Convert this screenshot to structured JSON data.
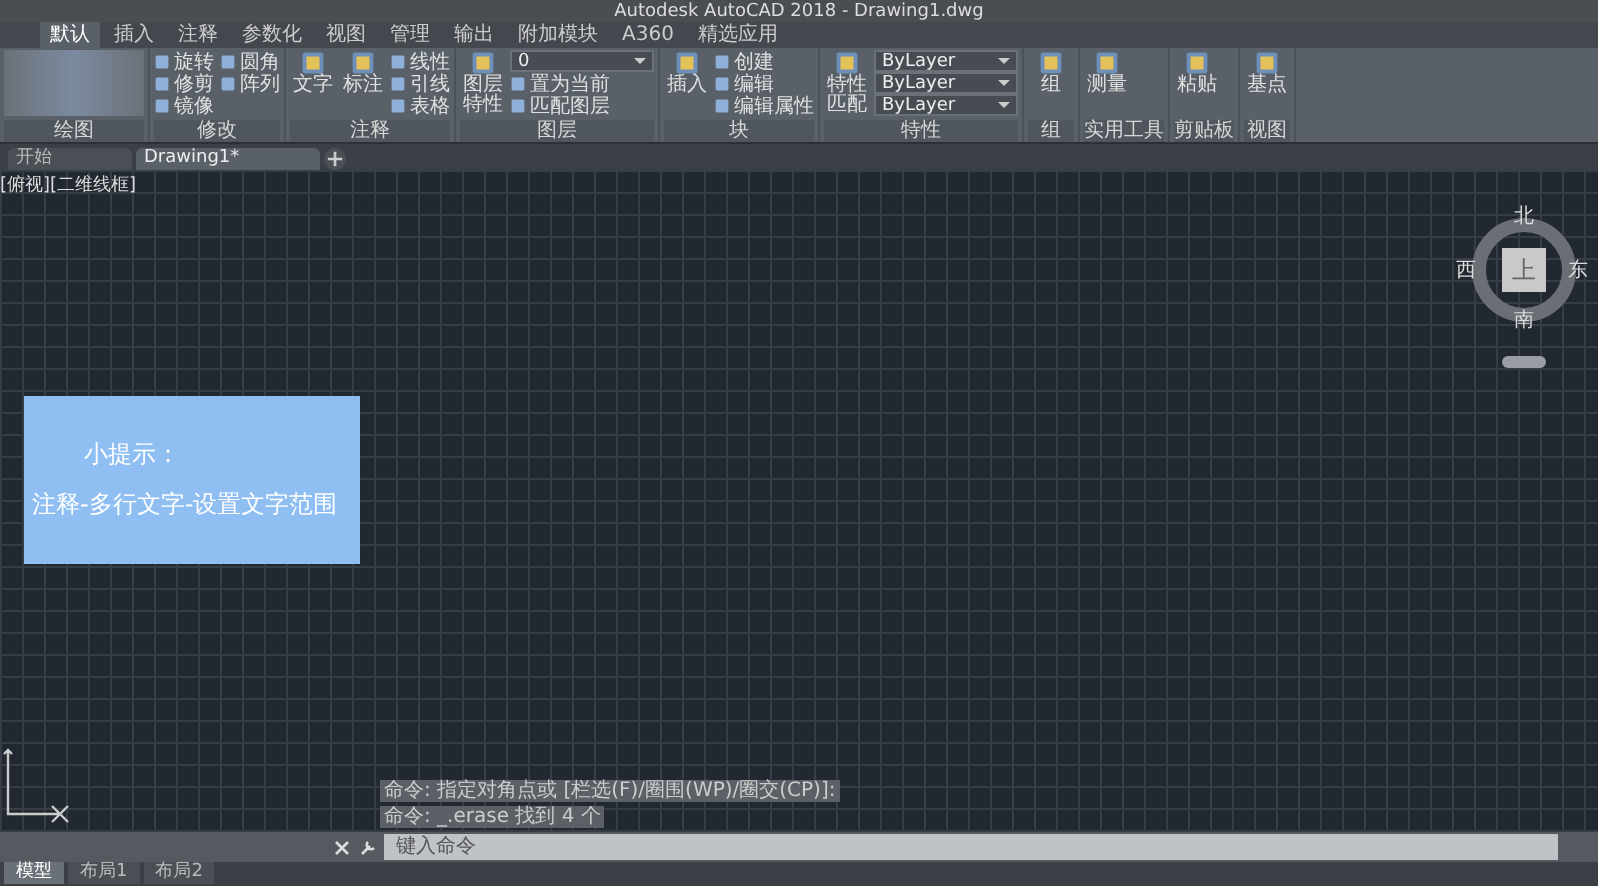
{
  "window": {
    "title": "Autodesk AutoCAD 2018 - Drawing1.dwg"
  },
  "ribbon_tabs": [
    {
      "label": "默认",
      "selected": true
    },
    {
      "label": "插入",
      "selected": false
    },
    {
      "label": "注释",
      "selected": false
    },
    {
      "label": "参数化",
      "selected": false
    },
    {
      "label": "视图",
      "selected": false
    },
    {
      "label": "管理",
      "selected": false
    },
    {
      "label": "输出",
      "selected": false
    },
    {
      "label": "附加模块",
      "selected": false
    },
    {
      "label": "A360",
      "selected": false
    },
    {
      "label": "精选应用",
      "selected": false
    }
  ],
  "ribbon_panels": [
    {
      "title": "绘图",
      "tools": [
        {
          "kind": "blurred"
        }
      ]
    },
    {
      "title": "修改",
      "tools": [
        {
          "kind": "small",
          "label": "旋转"
        },
        {
          "kind": "small",
          "label": "修剪"
        },
        {
          "kind": "small",
          "label": "镜像"
        },
        {
          "kind": "small",
          "label": "圆角"
        },
        {
          "kind": "small",
          "label": "阵列"
        }
      ]
    },
    {
      "title": "注释",
      "tools": [
        {
          "kind": "large",
          "label": "文字"
        },
        {
          "kind": "large",
          "label": "标注"
        },
        {
          "kind": "small",
          "label": "线性"
        },
        {
          "kind": "small",
          "label": "引线"
        },
        {
          "kind": "small",
          "label": "表格"
        }
      ]
    },
    {
      "title": "图层",
      "tools": [
        {
          "kind": "large",
          "label": "图层特性"
        },
        {
          "kind": "dropdown",
          "label": "0"
        },
        {
          "kind": "small",
          "label": "置为当前"
        },
        {
          "kind": "small",
          "label": "匹配图层"
        }
      ]
    },
    {
      "title": "块",
      "tools": [
        {
          "kind": "large",
          "label": "插入"
        },
        {
          "kind": "small",
          "label": "创建"
        },
        {
          "kind": "small",
          "label": "编辑"
        },
        {
          "kind": "small",
          "label": "编辑属性"
        }
      ]
    },
    {
      "title": "特性",
      "tools": [
        {
          "kind": "large",
          "label": "特性匹配"
        },
        {
          "kind": "dropdown",
          "label": "ByLayer"
        },
        {
          "kind": "dropdown",
          "label": "ByLayer"
        },
        {
          "kind": "dropdown",
          "label": "ByLayer"
        }
      ]
    },
    {
      "title": "组",
      "tools": [
        {
          "kind": "large",
          "label": "组"
        }
      ]
    },
    {
      "title": "实用工具",
      "tools": [
        {
          "kind": "large",
          "label": "测量"
        }
      ]
    },
    {
      "title": "剪贴板",
      "tools": [
        {
          "kind": "large",
          "label": "粘贴"
        }
      ]
    },
    {
      "title": "视图",
      "tools": [
        {
          "kind": "large",
          "label": "基点"
        }
      ]
    }
  ],
  "file_tabs": [
    {
      "label": "开始",
      "selected": false
    },
    {
      "label": "Drawing1*",
      "selected": true
    }
  ],
  "viewport_label": "[俯视][二维线框]",
  "hint": {
    "title": "小提示：",
    "text": "注释-多行文字-设置文字范围"
  },
  "viewcube": {
    "face": "上",
    "north": "北",
    "south": "南",
    "east": "东",
    "west": "西"
  },
  "command_history": [
    "命令: 指定对角点或 [栏选(F)/圈围(WP)/圈交(CP)]:",
    "命令: _.erase 找到 4 个"
  ],
  "command_input": {
    "placeholder": "键入命令"
  },
  "layout_tabs": [
    {
      "label": "模型",
      "selected": true
    },
    {
      "label": "布局1",
      "selected": false
    },
    {
      "label": "布局2",
      "selected": false
    }
  ]
}
